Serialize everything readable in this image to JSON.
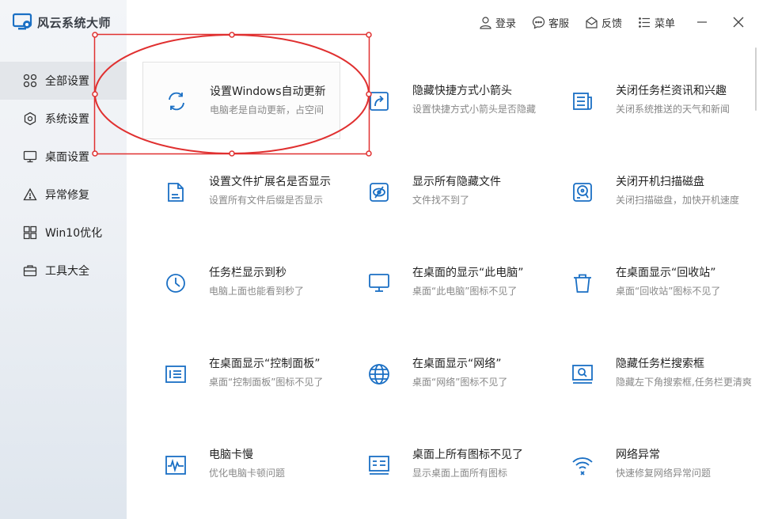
{
  "app": {
    "title": "风云系统大师",
    "brand_color": "#1a6fc4"
  },
  "topbar": {
    "login": "登录",
    "service": "客服",
    "feedback": "反馈",
    "menu": "菜单"
  },
  "sidebar": {
    "items": [
      {
        "label": "全部设置",
        "icon": "grid-icon",
        "active": true
      },
      {
        "label": "系统设置",
        "icon": "gear-icon",
        "active": false
      },
      {
        "label": "桌面设置",
        "icon": "monitor-icon",
        "active": false
      },
      {
        "label": "异常修复",
        "icon": "warning-icon",
        "active": false
      },
      {
        "label": "Win10优化",
        "icon": "windows-icon",
        "active": false
      },
      {
        "label": "工具大全",
        "icon": "toolbox-icon",
        "active": false
      }
    ]
  },
  "cards": [
    {
      "title": "设置Windows自动更新",
      "desc": "电脑老是自动更新，占空间",
      "icon": "refresh-icon"
    },
    {
      "title": "隐藏快捷方式小箭头",
      "desc": "设置快捷方式小箭头是否隐藏",
      "icon": "shortcut-arrow-icon"
    },
    {
      "title": "关闭任务栏资讯和兴趣",
      "desc": "关闭系统推送的天气和新闻",
      "icon": "news-icon"
    },
    {
      "title": "设置文件扩展名是否显示",
      "desc": "设置所有文件后缀是否显示",
      "icon": "file-icon"
    },
    {
      "title": "显示所有隐藏文件",
      "desc": "文件找不到了",
      "icon": "hidden-eye-icon"
    },
    {
      "title": "关闭开机扫描磁盘",
      "desc": "关闭扫描磁盘，加快开机速度",
      "icon": "disk-scan-icon"
    },
    {
      "title": "任务栏显示到秒",
      "desc": "电脑上面也能看到秒了",
      "icon": "clock-icon"
    },
    {
      "title": "在桌面的显示“此电脑”",
      "desc": "桌面“此电脑”图标不见了",
      "icon": "monitor-icon"
    },
    {
      "title": "在桌面显示“回收站”",
      "desc": "桌面“回收站”图标不见了",
      "icon": "trash-icon"
    },
    {
      "title": "在桌面显示“控制面板”",
      "desc": "桌面“控制面板”图标不见了",
      "icon": "control-panel-icon"
    },
    {
      "title": "在桌面显示“网络”",
      "desc": "桌面“网络”图标不见了",
      "icon": "globe-icon"
    },
    {
      "title": "隐藏任务栏搜索框",
      "desc": "隐藏左下角搜索框,任务栏更清爽",
      "icon": "search-box-icon"
    },
    {
      "title": "电脑卡慢",
      "desc": "优化电脑卡顿问题",
      "icon": "pulse-icon"
    },
    {
      "title": "桌面上所有图标不见了",
      "desc": "显示桌面上面所有图标",
      "icon": "desktop-icons-icon"
    },
    {
      "title": "网络异常",
      "desc": "快速修复网络异常问题",
      "icon": "wifi-error-icon"
    }
  ],
  "annotation_color": "#e03030",
  "icon_color": "#1a6fc4"
}
